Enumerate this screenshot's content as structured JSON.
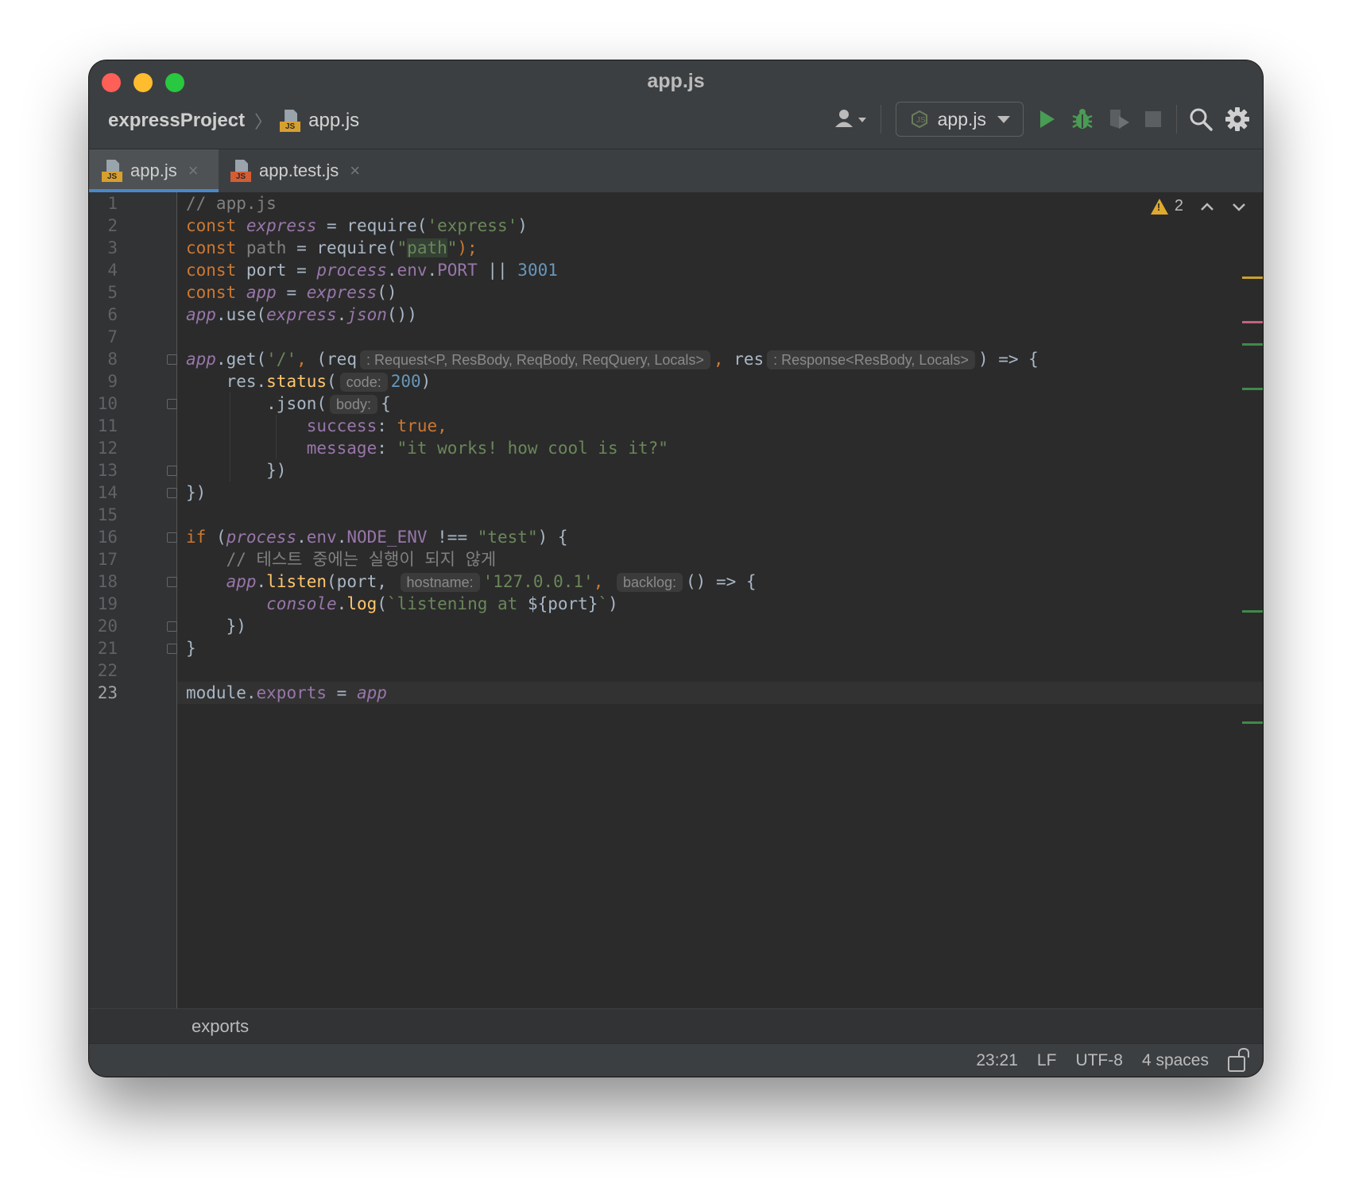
{
  "window": {
    "title": "app.js"
  },
  "breadcrumb": {
    "project": "expressProject",
    "file": "app.js"
  },
  "toolbar": {
    "run_config": "app.js"
  },
  "tabs": [
    {
      "label": "app.js",
      "active": true
    },
    {
      "label": "app.test.js",
      "active": false
    }
  ],
  "inspections": {
    "warning_count": "2"
  },
  "editor": {
    "current_line": 23,
    "line_numbers": [
      "1",
      "2",
      "3",
      "4",
      "5",
      "6",
      "7",
      "8",
      "9",
      "10",
      "11",
      "12",
      "13",
      "14",
      "15",
      "16",
      "17",
      "18",
      "19",
      "20",
      "21",
      "22",
      "23"
    ]
  },
  "code": {
    "l1_comment": "// app.js",
    "l2_const": "const ",
    "l2_var": "express",
    "l2_eq": " = require(",
    "l2_str": "'express'",
    "l2_end": ")",
    "l3_const": "const ",
    "l3_var": "path",
    "l3_eq": " = require(",
    "l3_q1": "\"",
    "l3_hl": "path",
    "l3_q2": "\"",
    "l3_end": ");",
    "l4_const": "const ",
    "l4_var": "port = ",
    "l4_proc": "process",
    "l4_dot": ".",
    "l4_env": "env",
    "l4_dot2": ".",
    "l4_port": "PORT",
    "l4_or": " || ",
    "l4_num": "3001",
    "l5_const": "const ",
    "l5_var": "app",
    "l5_eq": " = ",
    "l5_fn": "express",
    "l5_end": "()",
    "l6_app": "app",
    "l6_use": ".use(",
    "l6_ex": "express",
    "l6_dot": ".",
    "l6_json": "json",
    "l6_end": "())",
    "l8_app": "app",
    "l8_get": ".get(",
    "l8_str": "'/'",
    "l8_comma": ", ",
    "l8_paren": "(req",
    "l8_hint1": ": Request<P, ResBody, ReqBody, ReqQuery, Locals>",
    "l8_comma2": ", ",
    "l8_res": "res",
    "l8_hint2": ": Response<ResBody, Locals>",
    "l8_end": ") => {",
    "l9_res": "res.",
    "l9_status": "status",
    "l9_paren": "(",
    "l9_hint": "code:",
    "l9_num": "200",
    "l9_end": ")",
    "l10_json": ".json(",
    "l10_hint": "body:",
    "l10_brace": "{",
    "l11_key": "success",
    "l11_colon": ": ",
    "l11_val": "true,",
    "l12_key": "message",
    "l12_colon": ": ",
    "l12_val": "\"it works! how cool is it?\"",
    "l13_close": "})",
    "l14_close": "})",
    "l16_if": "if ",
    "l16_paren": "(",
    "l16_proc": "process",
    "l16_dot": ".",
    "l16_env": "env",
    "l16_dot2": ".",
    "l16_node": "NODE_ENV",
    "l16_op": " !== ",
    "l16_str": "\"test\"",
    "l16_end": ") {",
    "l17_comment": "// 테스트 중에는 실행이 되지 않게",
    "l18_app": "app",
    "l18_dot": ".",
    "l18_listen": "listen",
    "l18_port": "(port, ",
    "l18_hint1": "hostname:",
    "l18_str": "'127.0.0.1'",
    "l18_comma": ", ",
    "l18_hint2": "backlog:",
    "l18_end": "() => {",
    "l19_console": "console",
    "l19_dot": ".",
    "l19_log": "log",
    "l19_paren": "(",
    "l19_tpl": "`listening at ",
    "l19_interp": "${port}",
    "l19_tick": "`",
    "l19_end": ")",
    "l20_close": "})",
    "l21_close": "}",
    "l23_mod": "module.",
    "l23_exp": "exports",
    "l23_eq": " = ",
    "l23_app": "app"
  },
  "footer_crumb": "exports",
  "status": {
    "position": "23:21",
    "line_sep": "LF",
    "encoding": "UTF-8",
    "indent": "4 spaces"
  },
  "colors": {
    "accent": "#4a88c7",
    "run": "#499c54",
    "warning": "#e0a92e"
  }
}
